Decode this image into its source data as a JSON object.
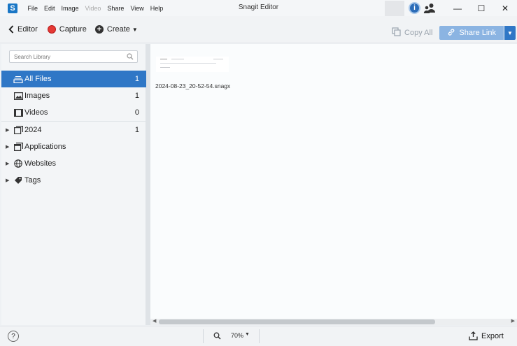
{
  "titlebar": {
    "app_logo_letter": "S",
    "menu": [
      "File",
      "Edit",
      "Image",
      "Video",
      "Share",
      "View",
      "Help"
    ],
    "disabled_menu": "Video",
    "title": "Snagit Editor",
    "info_letter": "i",
    "minimize": "—",
    "maximize": "☐",
    "close": "✕"
  },
  "toolbar": {
    "back_label": "Editor",
    "capture_label": "Capture",
    "create_label": "Create",
    "copy_all_label": "Copy All",
    "share_link_label": "Share Link"
  },
  "sidebar": {
    "search_placeholder": "Search Library",
    "items": [
      {
        "label": "All Files",
        "count": "1",
        "icon": "stack-icon",
        "selected": true
      },
      {
        "label": "Images",
        "count": "1",
        "icon": "image-icon"
      },
      {
        "label": "Videos",
        "count": "0",
        "icon": "film-icon"
      },
      {
        "label": "2024",
        "count": "1",
        "icon": "calendar-icon",
        "expandable": true
      },
      {
        "label": "Applications",
        "count": "",
        "icon": "window-icon",
        "expandable": true
      },
      {
        "label": "Websites",
        "count": "",
        "icon": "globe-icon",
        "expandable": true
      },
      {
        "label": "Tags",
        "count": "",
        "icon": "tag-icon",
        "expandable": true
      }
    ]
  },
  "main": {
    "files": [
      {
        "name": "2024-08-23_20-52-54.snagx"
      }
    ]
  },
  "statusbar": {
    "help": "?",
    "zoom": "70%",
    "export_label": "Export"
  },
  "colors": {
    "accent": "#2f77c6",
    "record": "#e53935",
    "share_link_bg": "#8bb4e2"
  }
}
